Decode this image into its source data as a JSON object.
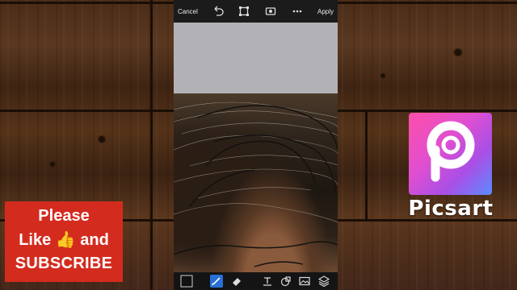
{
  "editor": {
    "cancel_label": "Cancel",
    "apply_label": "Apply",
    "top_icons": [
      "undo-icon",
      "crop-frame-icon",
      "video-record-icon",
      "more-icon"
    ],
    "bottom_icons": [
      "color-swatch-icon",
      "brush-icon",
      "eraser-icon",
      "text-tool-icon",
      "shape-icon",
      "image-icon",
      "layers-icon"
    ],
    "accent_color": "#2a6fd6"
  },
  "logo": {
    "icon": "picsart-logo-icon",
    "name": "Picsart"
  },
  "subscribe": {
    "line1": "Please",
    "line2_left": "Like",
    "line2_emoji": "👍",
    "line2_right": "and",
    "line3": "SUBSCRIBE",
    "background": "#d42b1f"
  }
}
